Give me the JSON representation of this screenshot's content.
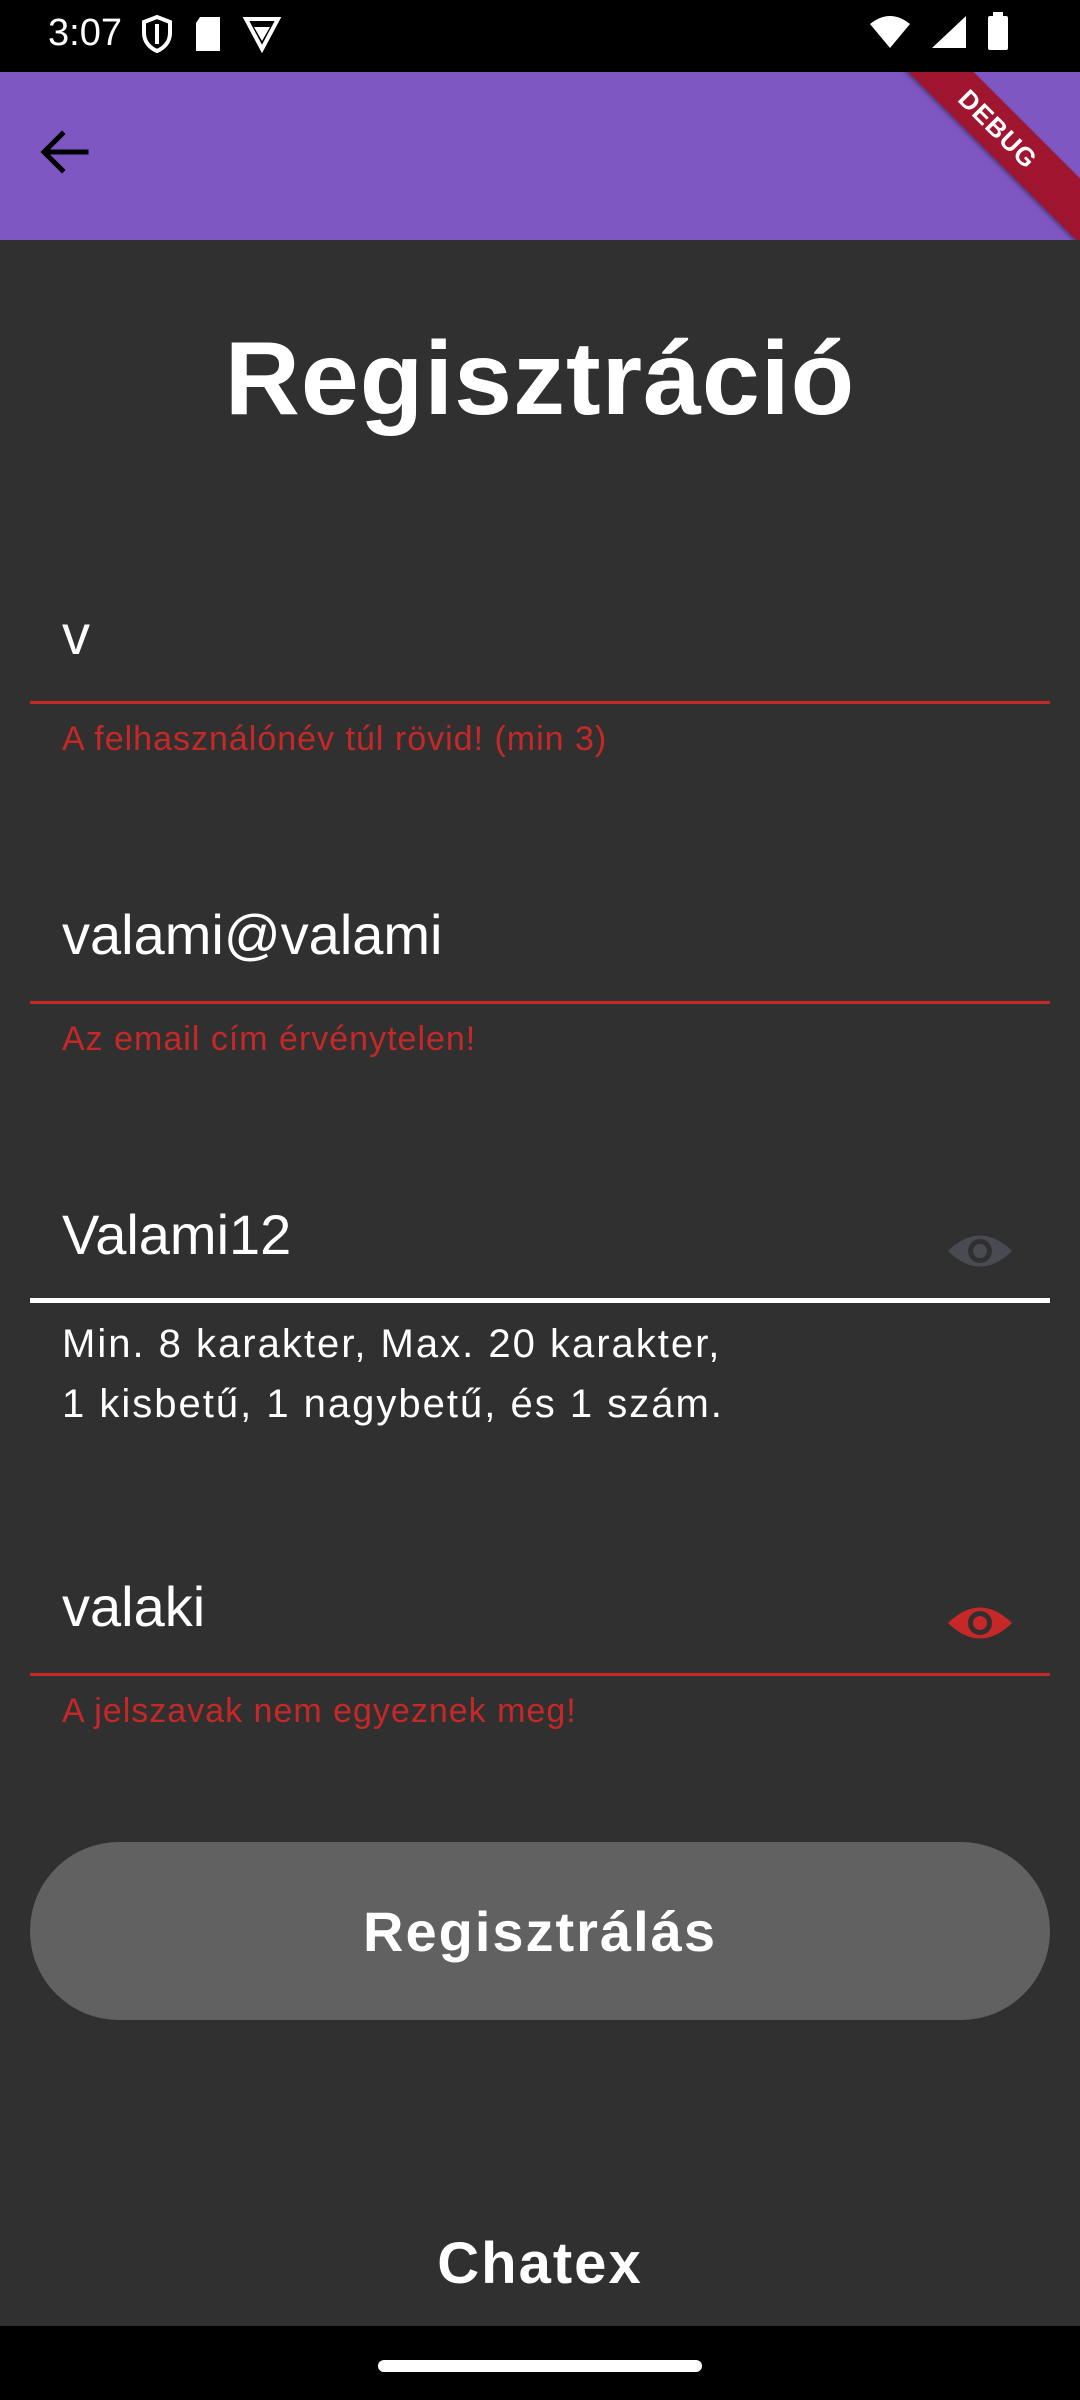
{
  "status_bar": {
    "time": "3:07",
    "icons_left": [
      "shield-icon",
      "sd-card-icon",
      "vpn-icon"
    ],
    "icons_right": [
      "wifi-icon",
      "signal-icon",
      "battery-icon"
    ]
  },
  "app_bar": {
    "back_icon": "arrow-back-icon",
    "color": "#7e57c2",
    "debug_banner": "DEBUG"
  },
  "page": {
    "title": "Regisztráció"
  },
  "form": {
    "username": {
      "value": "v",
      "error": "A felhasználónév túl rövid! (min 3)"
    },
    "email": {
      "value": "valami@valami",
      "error": "Az email cím érvénytelen!"
    },
    "password": {
      "value": "Valami12",
      "helper_line1": "Min. 8 karakter, Max. 20 karakter,",
      "helper_line2": "1 kisbetű, 1 nagybetű, és 1 szám.",
      "visibility_icon": "eye-icon"
    },
    "password_confirm": {
      "value": "valaki",
      "error": "A jelszavak nem egyeznek meg!",
      "visibility_icon": "eye-icon"
    },
    "submit_label": "Regisztrálás"
  },
  "footer": {
    "brand": "Chatex"
  },
  "colors": {
    "background": "#303030",
    "error": "#c62828",
    "button": "#616161"
  }
}
